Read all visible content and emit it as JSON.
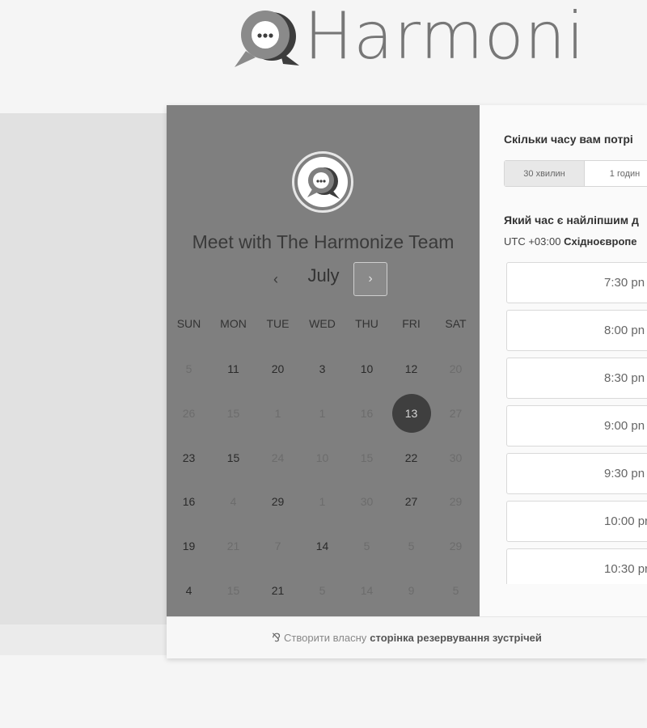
{
  "brand": {
    "name": "Harmoni"
  },
  "calendar": {
    "title": "Meet with The Harmonize Team",
    "month": "July",
    "prev_icon": "‹",
    "next_icon": "›",
    "weekdays": [
      "SUN",
      "MON",
      "TUE",
      "WED",
      "THU",
      "FRI",
      "SAT"
    ],
    "weeks": [
      [
        "5",
        "11",
        "20",
        "3",
        "10",
        "12",
        "20"
      ],
      [
        "26",
        "15",
        "1",
        "1",
        "16",
        "13",
        "27"
      ],
      [
        "23",
        "15",
        "24",
        "10",
        "15",
        "22",
        "30"
      ],
      [
        "16",
        "4",
        "29",
        "1",
        "30",
        "27",
        "29"
      ],
      [
        "19",
        "21",
        "7",
        "14",
        "5",
        "5",
        "29"
      ],
      [
        "4",
        "15",
        "21",
        "5",
        "14",
        "9",
        "5"
      ]
    ],
    "selected": "13"
  },
  "booking": {
    "duration_question": "Скільки часу вам потрі",
    "durations": [
      "30 хвилин",
      "1 годин"
    ],
    "time_question": "Який час є найліпшим д",
    "timezone_offset": "UTC +03:00",
    "timezone_name": "Східноєвропе",
    "slots": [
      "7:30 pn",
      "8:00 pn",
      "8:30 pn",
      "9:00 pn",
      "9:30 pn",
      "10:00 pr",
      "10:30 pr"
    ]
  },
  "footer": {
    "text": "Створити власну",
    "link": "сторінка резервування зустрічей"
  }
}
